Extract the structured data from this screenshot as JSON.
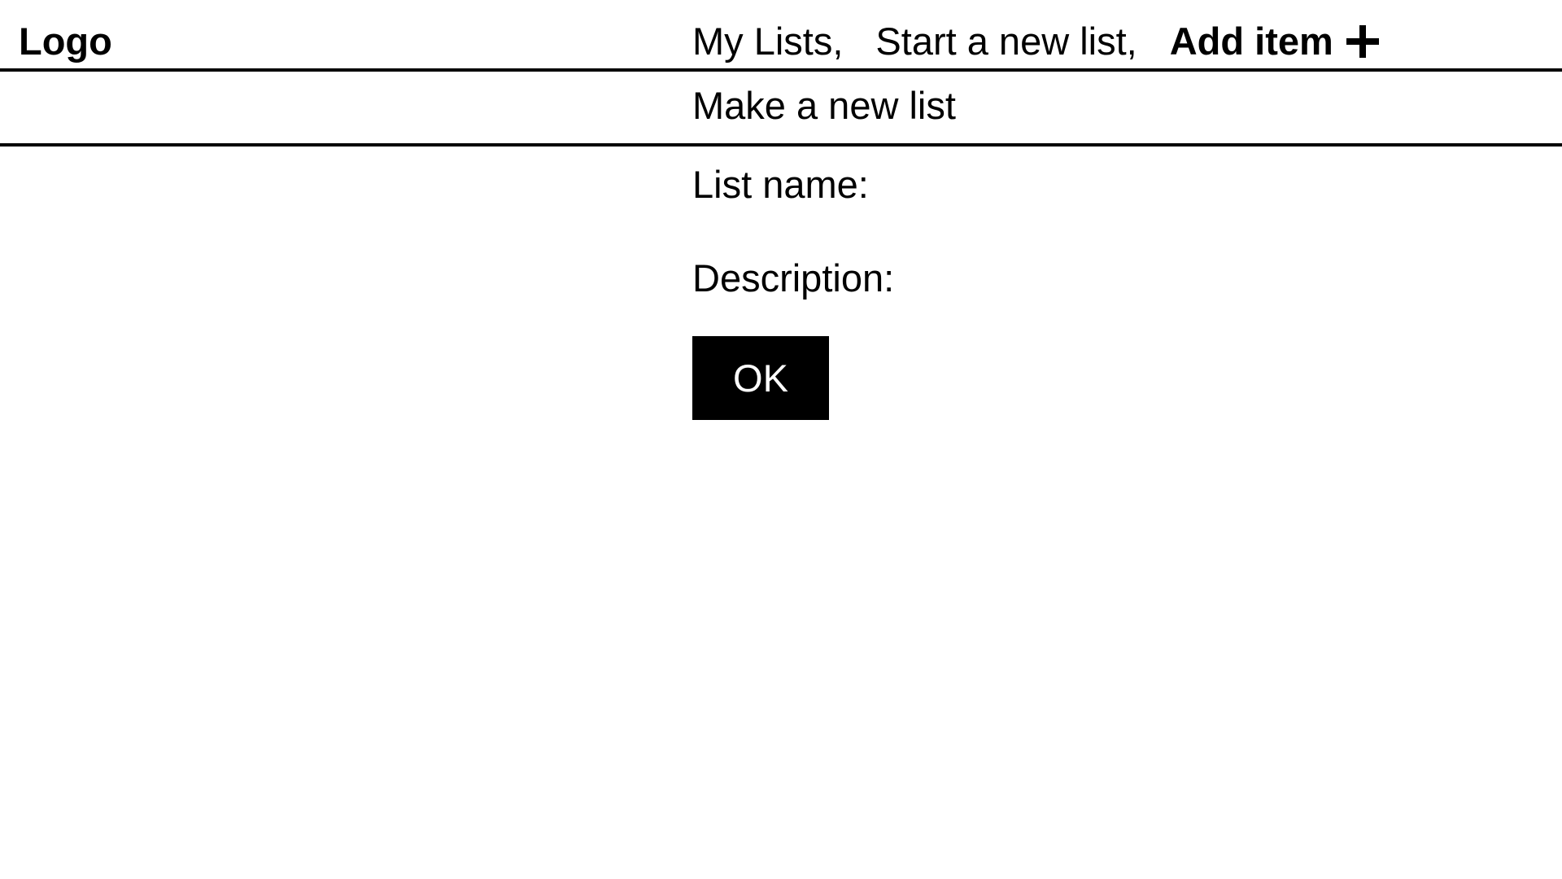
{
  "header": {
    "logo": "Logo",
    "nav": {
      "my_lists": "My Lists,",
      "start_new_list": "Start a new list,",
      "add_item": "Add item",
      "add_item_icon": "plus-icon"
    }
  },
  "subheader": {
    "title": "Make a new list"
  },
  "form": {
    "list_name_label": "List name:",
    "description_label": "Description:",
    "ok_button": "OK"
  }
}
